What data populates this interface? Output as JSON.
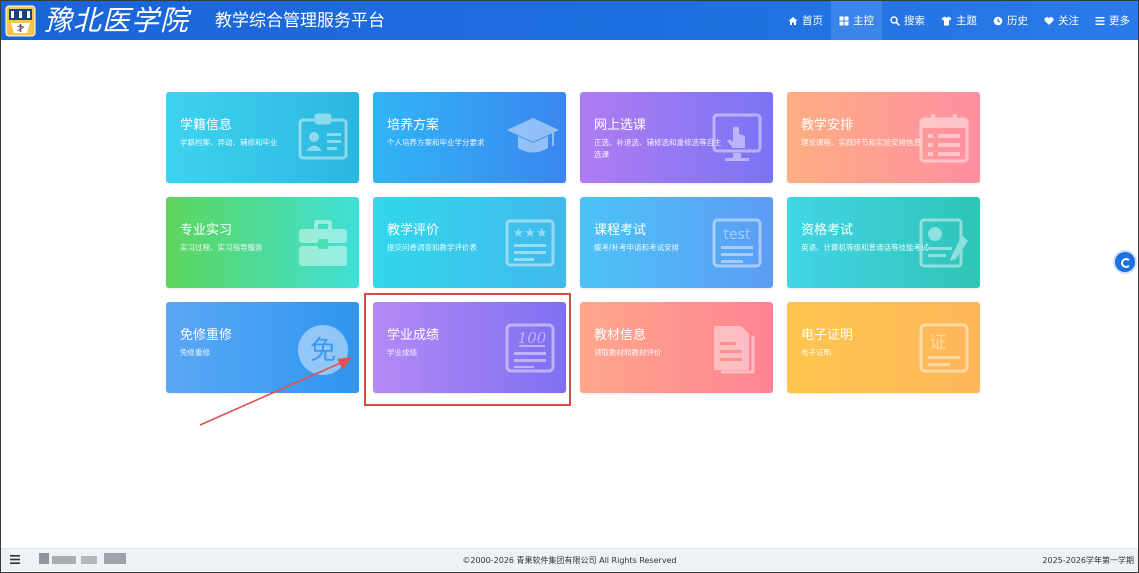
{
  "header": {
    "school_name": "豫北医学院",
    "platform_title": "教学综合管理服务平台",
    "nav": [
      {
        "label": "首页",
        "icon": "home-icon",
        "active": false
      },
      {
        "label": "主控",
        "icon": "grid-icon",
        "active": true
      },
      {
        "label": "搜索",
        "icon": "search-icon",
        "active": false
      },
      {
        "label": "主题",
        "icon": "shirt-icon",
        "active": false
      },
      {
        "label": "历史",
        "icon": "clock-icon",
        "active": false
      },
      {
        "label": "关注",
        "icon": "heart-icon",
        "active": false
      },
      {
        "label": "更多",
        "icon": "menu-icon",
        "active": false
      }
    ]
  },
  "tiles": [
    {
      "title": "学籍信息",
      "desc": "学籍档案、异动、辅修和毕业",
      "icon": "id-card-icon",
      "colors": [
        "#3fd3f0",
        "#2bb6de"
      ]
    },
    {
      "title": "培养方案",
      "desc": "个人培养方案和毕业学分要求",
      "icon": "graduation-cap-icon",
      "colors": [
        "#31b5f5",
        "#3a86f0"
      ]
    },
    {
      "title": "网上选课",
      "desc": "正选、补退选、辅修选和重修选等自主选课",
      "icon": "touch-screen-icon",
      "colors": [
        "#b07cf2",
        "#7a74f4"
      ]
    },
    {
      "title": "教学安排",
      "desc": "理论课程、实践环节和实验安排信息",
      "icon": "calendar-icon",
      "colors": [
        "#fdae84",
        "#ff8fa1"
      ]
    },
    {
      "title": "专业实习",
      "desc": "实习过程、实习指导服务",
      "icon": "toolbox-icon",
      "colors": [
        "#5ed65c",
        "#3fe0d8"
      ]
    },
    {
      "title": "教学评价",
      "desc": "提交问卷调查和教学评价表",
      "icon": "rating-icon",
      "colors": [
        "#32d7ec",
        "#41b9ec"
      ]
    },
    {
      "title": "课程考试",
      "desc": "缓考/补考申请和考试安排",
      "icon": "test-paper-icon",
      "colors": [
        "#4dc3f7",
        "#5d9cf5"
      ]
    },
    {
      "title": "资格考试",
      "desc": "英语、计算机等级和普通话等技能考试",
      "icon": "certificate-icon",
      "colors": [
        "#42d5e5",
        "#2fc4b8"
      ]
    },
    {
      "title": "免修重修",
      "desc": "免修重修",
      "icon": "exempt-badge-icon",
      "colors": [
        "#5ba8f5",
        "#2f95f0"
      ]
    },
    {
      "title": "学业成绩",
      "desc": "学业成绩",
      "icon": "score-sheet-icon",
      "colors": [
        "#b48af4",
        "#7e6ff2"
      ]
    },
    {
      "title": "教材信息",
      "desc": "领取教材和教材评价",
      "icon": "textbook-icon",
      "colors": [
        "#ffa78c",
        "#ff8393"
      ]
    },
    {
      "title": "电子证明",
      "desc": "电子证明",
      "icon": "e-certificate-icon",
      "colors": [
        "#ffc54f",
        "#ffb65a"
      ]
    }
  ],
  "footer": {
    "copyright": "©2000-2026 青果软件集团有限公司 All Rights Reserved",
    "term": "2025-2026学年第一学期"
  }
}
